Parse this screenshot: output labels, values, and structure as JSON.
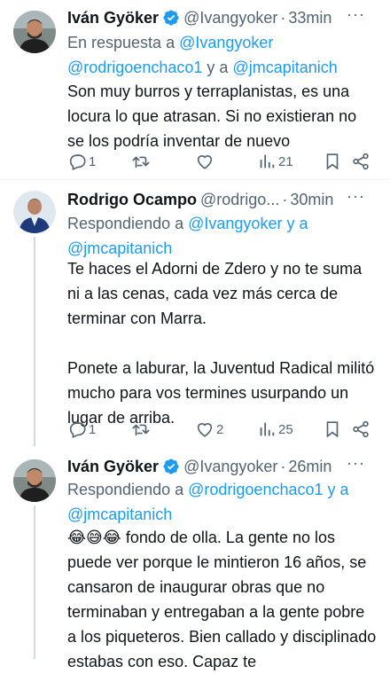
{
  "tweets": [
    {
      "name": "Iván Gyöker",
      "handle": "@Ivangyoker",
      "time": "33min",
      "reply_prefix": "En respuesta a",
      "reply_users": [
        "@Ivangyoker",
        "@rodrigoenchaco1"
      ],
      "reply_join": "y a",
      "reply_last": "@jmcapitanich",
      "text": "Son muy burros y terraplanistas, es una locura lo que atrasan. Si no existieran no se los podría inventar de nuevo",
      "replies": "1",
      "retweets": "",
      "likes": "",
      "views": "21"
    },
    {
      "name": "Rodrigo Ocampo",
      "handle": "@rodrigo...",
      "time": "30min",
      "reply_prefix": "Respondiendo a",
      "reply_users": [
        "@Ivangyoker"
      ],
      "reply_join": "y a",
      "reply_last": "@jmcapitanich",
      "text": "Te haces el Adorni de Zdero y no te suma ni a las cenas, cada vez más cerca de terminar con Marra.\n\nPonete a laburar, la Juventud Radical militó mucho para vos termines usurpando un lugar de arriba.",
      "replies": "1",
      "retweets": "",
      "likes": "2",
      "views": "25"
    },
    {
      "name": "Iván Gyöker",
      "handle": "@Ivangyoker",
      "time": "26min",
      "reply_prefix": "Respondiendo a",
      "reply_users": [
        "@rodrigoenchaco1"
      ],
      "reply_join": "y a",
      "reply_last": "@jmcapitanich",
      "emoji": "😂😅😂",
      "text": " fondo de olla. La gente no los puede ver porque le mintieron 16 años, se cansaron de inaugurar obras que no terminaban y entregaban a la gente pobre a los piqueteros. Bien callado y disciplinado estabas con eso. Capaz te"
    }
  ]
}
